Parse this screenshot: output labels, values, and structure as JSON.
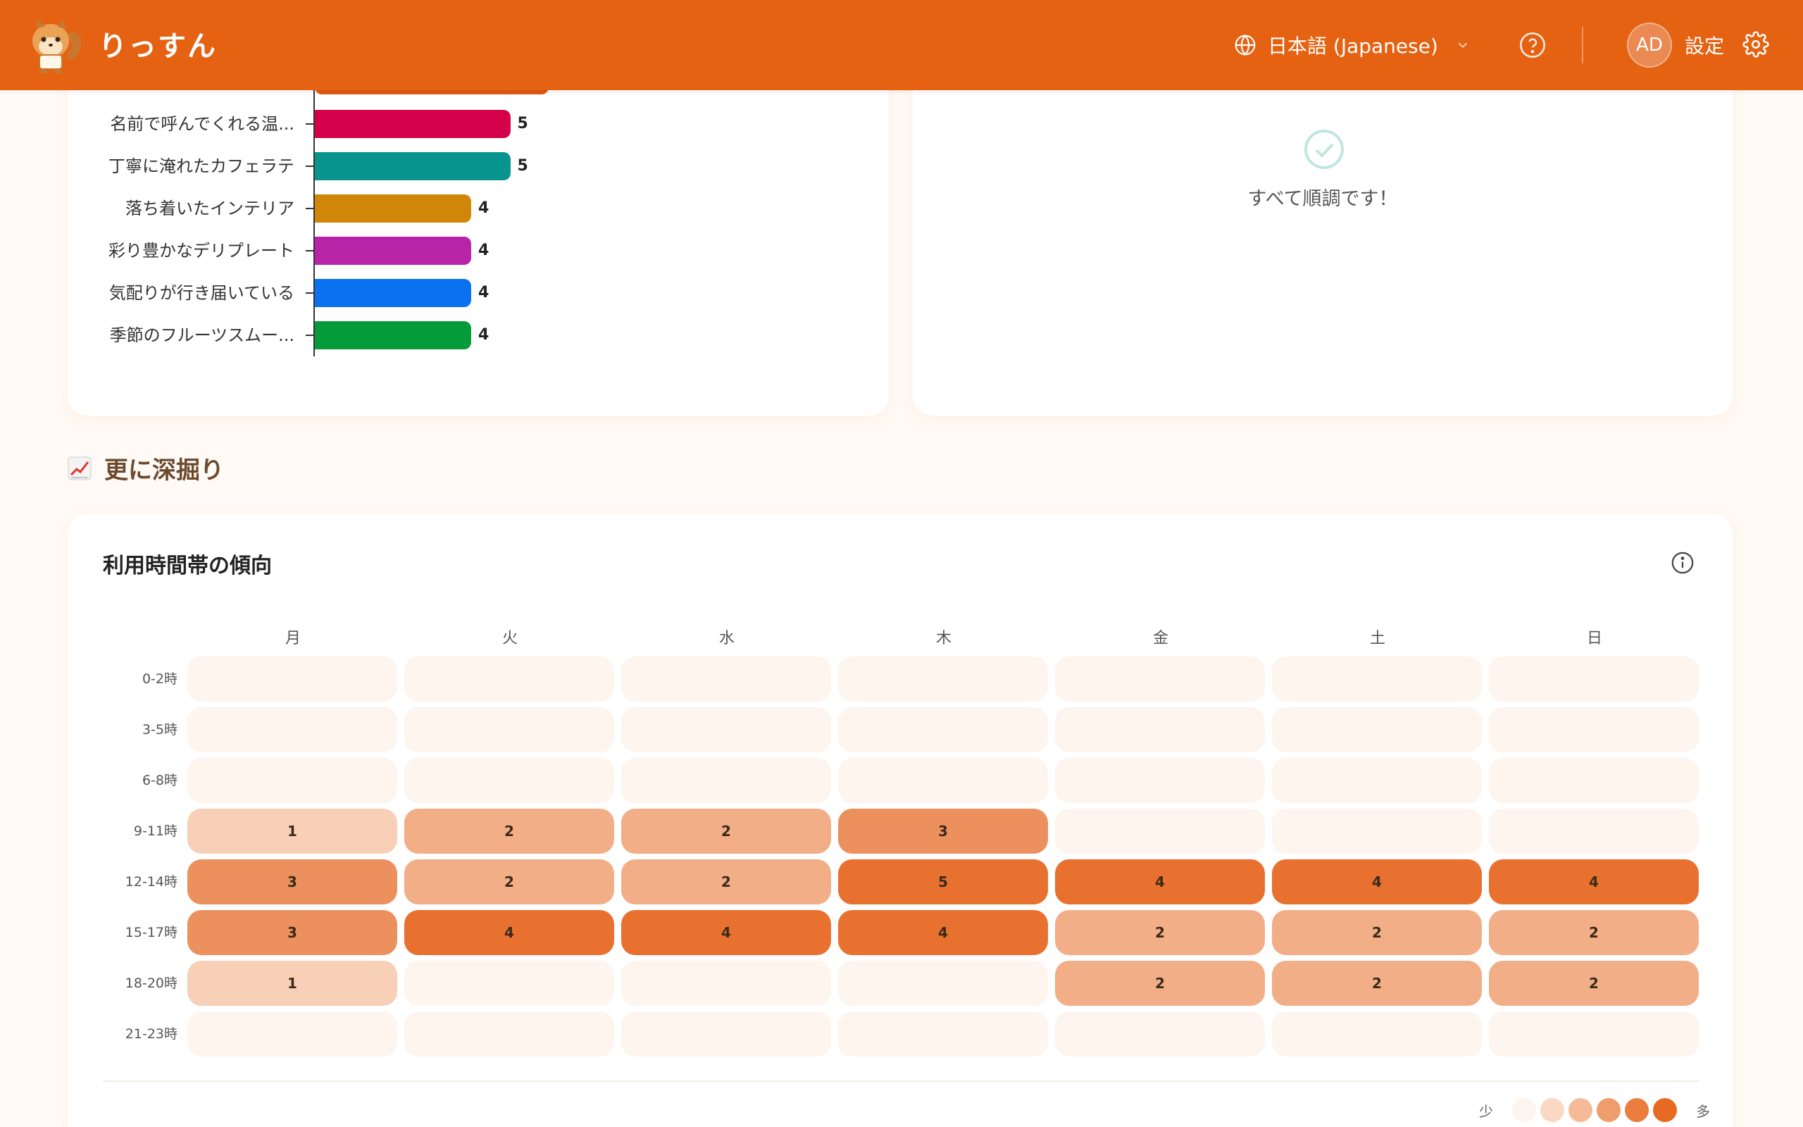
{
  "header": {
    "app_name": "りっすん",
    "language": "日本語 (Japanese)",
    "avatar_initials": "AD",
    "settings_label": "設定"
  },
  "colors": {
    "brand": "#e46212",
    "heat_levels": [
      "#fdf5ee",
      "#f8d0b7",
      "#f2ae86",
      "#ec915e",
      "#e87130"
    ]
  },
  "bar_chart": {
    "chart_data": {
      "type": "bar",
      "orientation": "horizontal",
      "categories": [
        "名前で呼んでくれる温...",
        "丁寧に淹れたカフェラテ",
        "落ち着いたインテリア",
        "彩り豊かなデリプレート",
        "気配りが行き届いている",
        "季節のフルーツスムー..."
      ],
      "values": [
        5,
        5,
        4,
        4,
        4,
        4
      ],
      "colors": [
        "#d4004a",
        "#08958f",
        "#d08608",
        "#b724a8",
        "#0a72ee",
        "#059a3a"
      ]
    }
  },
  "status_card": {
    "message": "すべて順調です！"
  },
  "section": {
    "title": "更に深掘り"
  },
  "heatmap": {
    "title": "利用時間帯の傾向",
    "chart_data": {
      "type": "heatmap",
      "days": [
        "月",
        "火",
        "水",
        "木",
        "金",
        "土",
        "日"
      ],
      "hours": [
        "0-2時",
        "3-5時",
        "6-8時",
        "9-11時",
        "12-14時",
        "15-17時",
        "18-20時",
        "21-23時"
      ],
      "values": [
        [
          0,
          0,
          0,
          0,
          0,
          0,
          0
        ],
        [
          0,
          0,
          0,
          0,
          0,
          0,
          0
        ],
        [
          0,
          0,
          0,
          0,
          0,
          0,
          0
        ],
        [
          1,
          2,
          2,
          3,
          0,
          0,
          0
        ],
        [
          3,
          2,
          2,
          5,
          4,
          4,
          4
        ],
        [
          3,
          4,
          4,
          4,
          2,
          2,
          2
        ],
        [
          1,
          0,
          0,
          0,
          2,
          2,
          2
        ],
        [
          0,
          0,
          0,
          0,
          0,
          0,
          0
        ]
      ]
    },
    "legend": {
      "low": "少",
      "high": "多",
      "colors": [
        "#fdf5ee",
        "#fad8c4",
        "#f5bb96",
        "#ef9d6a",
        "#eb7d3e",
        "#e66a22"
      ]
    }
  }
}
